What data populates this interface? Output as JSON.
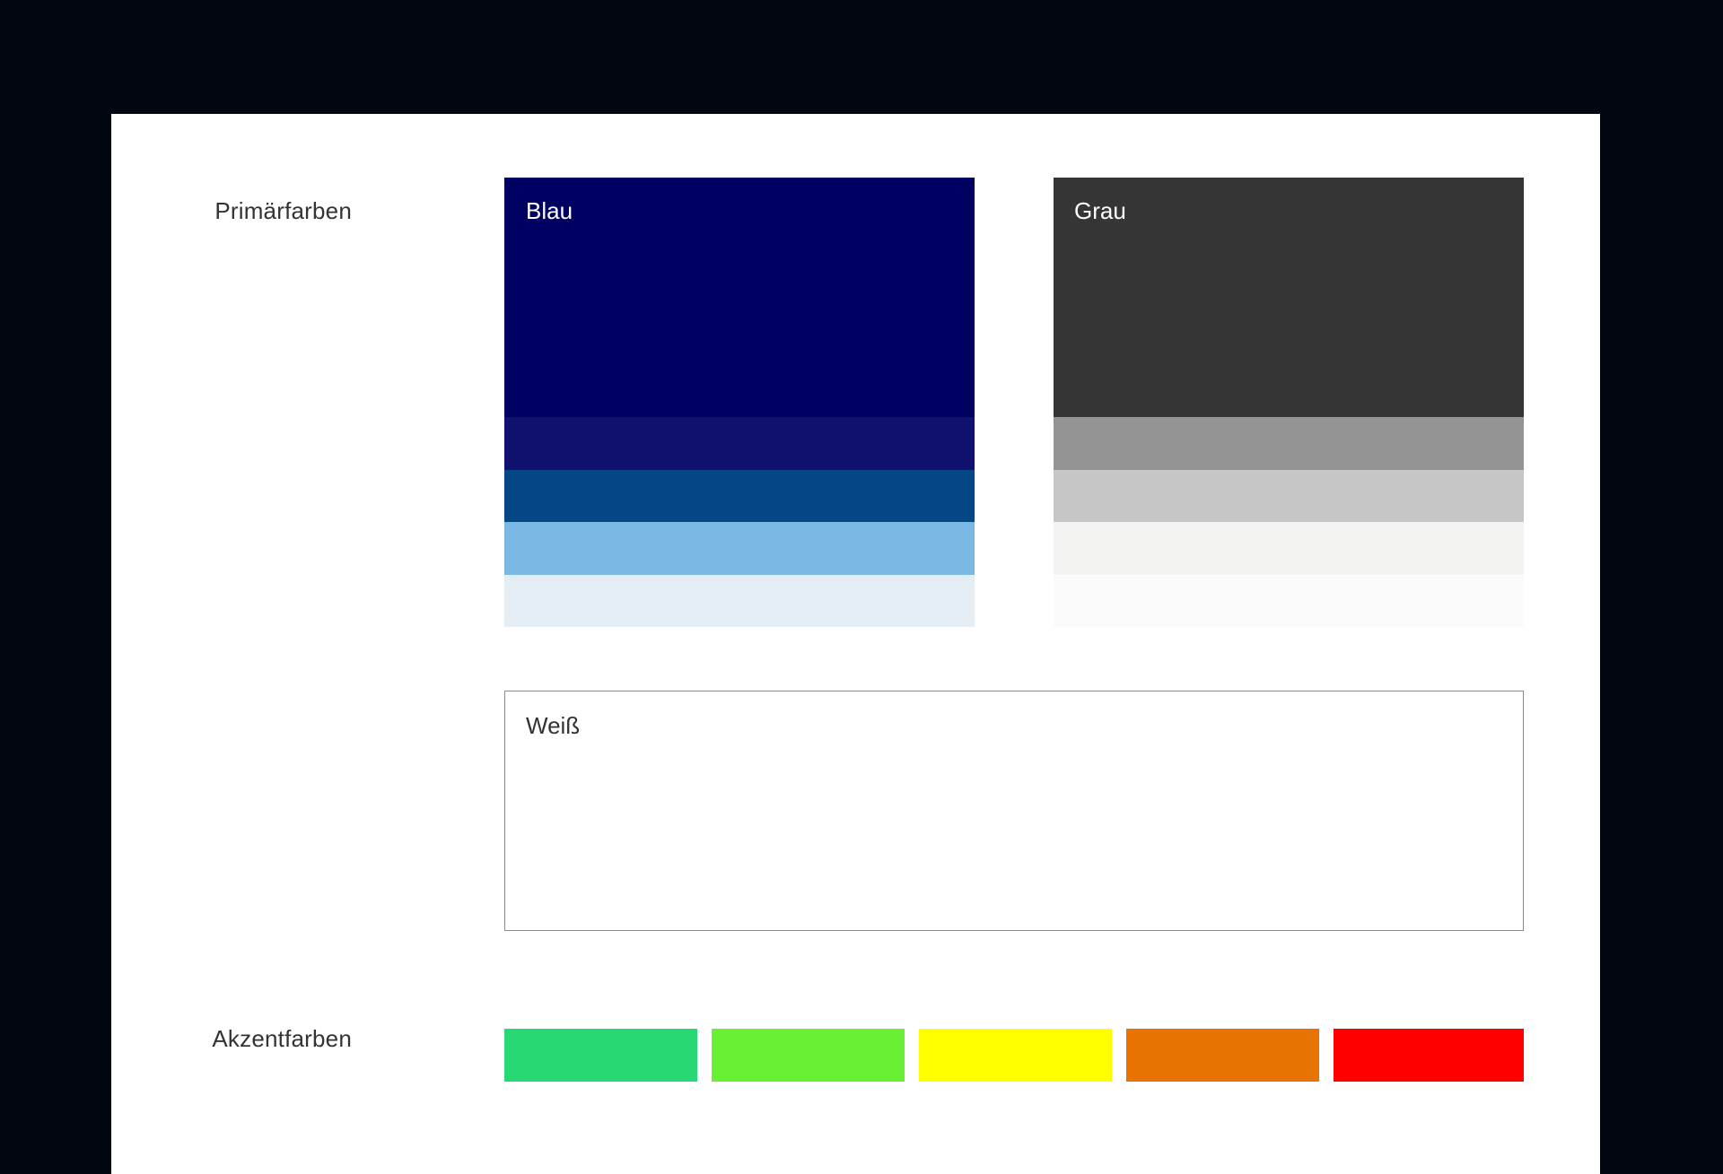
{
  "primary": {
    "label": "Primärfarben",
    "blue": {
      "name": "Blau",
      "main_color": "#000062",
      "tints": [
        "#10106e",
        "#054685",
        "#7bb9e5",
        "#e5edf4"
      ]
    },
    "grey": {
      "name": "Grau",
      "main_color": "#353535",
      "tints": [
        "#949494",
        "#c6c6c6",
        "#f3f3f1",
        "#fbfbfb"
      ]
    },
    "white": {
      "name": "Weiß",
      "main_color": "#ffffff"
    }
  },
  "accent": {
    "label": "Akzentfarben",
    "colors": [
      "#28d874",
      "#69f032",
      "#ffff00",
      "#e87302",
      "#fe0000"
    ]
  }
}
